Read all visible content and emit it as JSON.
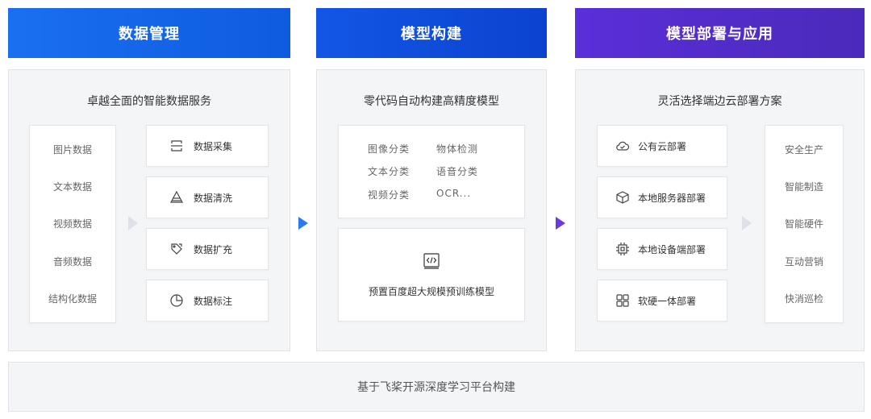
{
  "columns": [
    {
      "header": "数据管理",
      "subtitle": "卓越全面的智能数据服务",
      "data_types": [
        "图片数据",
        "文本数据",
        "视频数据",
        "音频数据",
        "结构化数据"
      ],
      "services": [
        {
          "label": "数据采集",
          "icon": "data-collection-icon"
        },
        {
          "label": "数据清洗",
          "icon": "data-cleaning-icon"
        },
        {
          "label": "数据扩充",
          "icon": "data-augmentation-icon"
        },
        {
          "label": "数据标注",
          "icon": "data-annotation-icon"
        }
      ]
    },
    {
      "header": "模型构建",
      "subtitle": "零代码自动构建高精度模型",
      "tasks": [
        "图像分类",
        "物体检测",
        "文本分类",
        "语音分类",
        "视频分类",
        "OCR..."
      ],
      "pretrained": {
        "label": "预置百度超大规模预训练模型",
        "icon": "code-window-icon"
      }
    },
    {
      "header": "模型部署与应用",
      "subtitle": "灵活选择端边云部署方案",
      "deployments": [
        {
          "label": "公有云部署",
          "icon": "cloud-check-icon"
        },
        {
          "label": "本地服务器部署",
          "icon": "server-box-icon"
        },
        {
          "label": "本地设备端部署",
          "icon": "chip-icon"
        },
        {
          "label": "软硬一体部署",
          "icon": "grid-blocks-icon"
        }
      ],
      "applications": [
        "安全生产",
        "智能制造",
        "智能硬件",
        "互动营销",
        "快消巡检"
      ]
    }
  ],
  "footer": "基于飞桨开源深度学习平台构建",
  "colors": {
    "header1": "#1a6ff0",
    "header2": "#1356e6",
    "header3": "#5b2ed9",
    "panel_bg": "#f4f5f7"
  }
}
